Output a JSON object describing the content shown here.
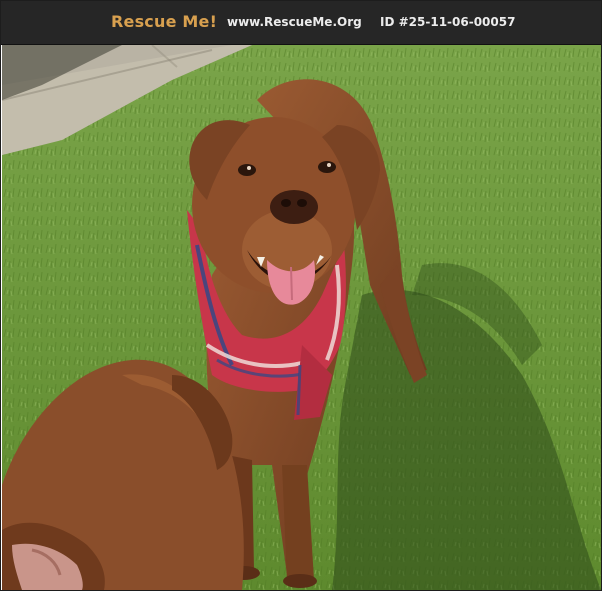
{
  "header": {
    "brand": "Rescue Me!",
    "site": "www.RescueMe.Org",
    "pet_id": "ID #25-11-06-00057"
  },
  "photo": {
    "subject_icon": "dog-photo",
    "colors": {
      "grass": "#6f9a3a",
      "dog_coat": "#8a4f2c",
      "bandana": "#c8364a"
    }
  },
  "colors": {
    "header_bg": "#262626",
    "brand": "#d8a04f",
    "text": "#ececec"
  }
}
